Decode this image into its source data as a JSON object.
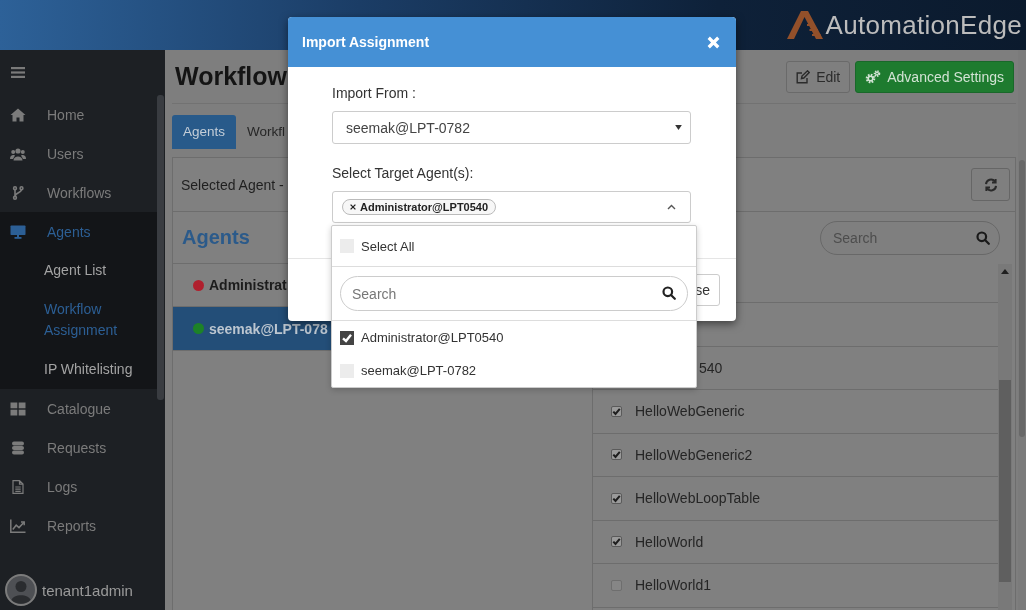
{
  "header": {
    "logo_text": "AutomationEdge"
  },
  "sidebar": {
    "items": [
      {
        "label": "Home",
        "selected": false,
        "expanded": false
      },
      {
        "label": "Users",
        "selected": false,
        "expanded": false
      },
      {
        "label": "Workflows",
        "selected": false,
        "expanded": false
      },
      {
        "label": "Agents",
        "selected": true,
        "expanded": true,
        "children": [
          {
            "label": "Agent List",
            "selected": false
          },
          {
            "label": "Workflow Assignment",
            "selected": true
          },
          {
            "label": "IP Whitelisting",
            "selected": false
          }
        ]
      },
      {
        "label": "Catalogue",
        "selected": false,
        "expanded": false
      },
      {
        "label": "Requests",
        "selected": false,
        "expanded": false
      },
      {
        "label": "Logs",
        "selected": false,
        "expanded": false
      },
      {
        "label": "Reports",
        "selected": false,
        "expanded": false
      }
    ],
    "user": {
      "name": "tenant1admin"
    }
  },
  "page": {
    "title": "Workflow",
    "buttons": [
      {
        "label": "Edit",
        "kind": "default"
      },
      {
        "label": "Advanced Settings",
        "kind": "primary"
      }
    ],
    "tabs": [
      {
        "label": "Agents",
        "selected": true
      },
      {
        "label": "Workfl",
        "selected": false
      }
    ],
    "selected_agent_label": "Selected Agent -",
    "agents_panel": {
      "title": "Agents",
      "agents": [
        {
          "name": "Administrat",
          "selected": false,
          "color": "#b0202e"
        },
        {
          "name": "seemak@LPT-078",
          "selected": true,
          "color": "#1d8228"
        }
      ]
    },
    "workflows_panel": {
      "search": {
        "placeholder": "Search"
      },
      "rows": [
        {
          "kind": "partial",
          "label": "540"
        },
        {
          "kind": "check",
          "label": "HelloWebGeneric",
          "checked": true
        },
        {
          "kind": "check",
          "label": "HelloWebGeneric2",
          "checked": true
        },
        {
          "kind": "check",
          "label": "HelloWebLoopTable",
          "checked": true
        },
        {
          "kind": "check",
          "label": "HelloWorld",
          "checked": true
        },
        {
          "kind": "check",
          "label": "HelloWorld1",
          "checked": false
        }
      ]
    }
  },
  "modal": {
    "title": "Import Assignment",
    "import_from": {
      "label": "Import From :",
      "value": "seemak@LPT-0782"
    },
    "target": {
      "label": "Select Target Agent(s):",
      "tags": [
        "Administrator@LPT0540"
      ],
      "expanded": true,
      "select_all": {
        "label": "Select All",
        "checked": false
      },
      "search": {
        "placeholder": "Search"
      },
      "options": [
        {
          "label": "Administrator@LPT0540",
          "checked": true
        },
        {
          "label": "seemak@LPT-0782",
          "checked": false
        }
      ]
    },
    "footer_button": "se"
  }
}
